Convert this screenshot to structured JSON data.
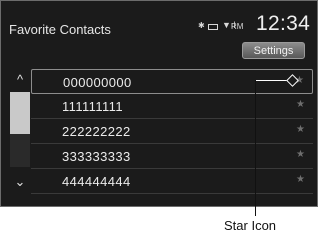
{
  "header": {
    "title": "Favorite Contacts",
    "status": {
      "bluetooth": "✱",
      "signal": "▼ıl",
      "text": "RM"
    },
    "clock": "12:34",
    "settings_label": "Settings"
  },
  "scroll": {
    "up": "^",
    "down": "⌄"
  },
  "contacts": [
    {
      "number": "000000000",
      "star": "★"
    },
    {
      "number": "111111111",
      "star": "★"
    },
    {
      "number": "222222222",
      "star": "★"
    },
    {
      "number": "333333333",
      "star": "★"
    },
    {
      "number": "444444444",
      "star": "★"
    }
  ],
  "callout": {
    "label": "Star Icon"
  }
}
